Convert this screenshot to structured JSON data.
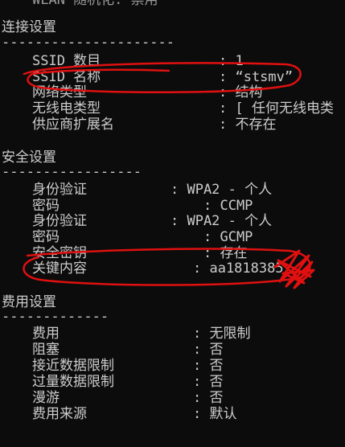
{
  "top_partial": "WLAN 随机化: 禁用",
  "connectivity": {
    "title": "连接设置",
    "separator": "---------------------",
    "rows": [
      {
        "label": "SSID 数目",
        "value": ": 1"
      },
      {
        "label": "SSID 名称",
        "value": ": “stsmv”"
      },
      {
        "label": "网络类型",
        "value": ": 结构"
      },
      {
        "label": "无线电类型",
        "value": ": [ 任何无线电类"
      },
      {
        "label": "供应商扩展名",
        "value": ": 不存在"
      }
    ]
  },
  "security": {
    "title": "安全设置",
    "separator": "-----------------",
    "rows": [
      {
        "label": "身份验证",
        "value": ": WPA2 - 个人"
      },
      {
        "label": "密码",
        "value": ": CCMP"
      },
      {
        "label": "身份验证",
        "value": ": WPA2 - 个人"
      },
      {
        "label": "密码",
        "value": ": GCMP"
      },
      {
        "label": "安全密钥",
        "value": ": 存在"
      },
      {
        "label": "关键内容",
        "value": ": aa1818385"
      }
    ]
  },
  "cost": {
    "title": "费用设置",
    "separator": "-------------",
    "rows": [
      {
        "label": "费用",
        "value": ": 无限制"
      },
      {
        "label": "阻塞",
        "value": ": 否"
      },
      {
        "label": "接近数据限制",
        "value": ": 否"
      },
      {
        "label": "过量数据限制",
        "value": ": 否"
      },
      {
        "label": "漫游",
        "value": ": 否"
      },
      {
        "label": "费用来源",
        "value": ": 默认"
      }
    ]
  },
  "colors": {
    "background": "#0c0c0c",
    "text": "#cccccc",
    "annotation": "#e01010"
  }
}
